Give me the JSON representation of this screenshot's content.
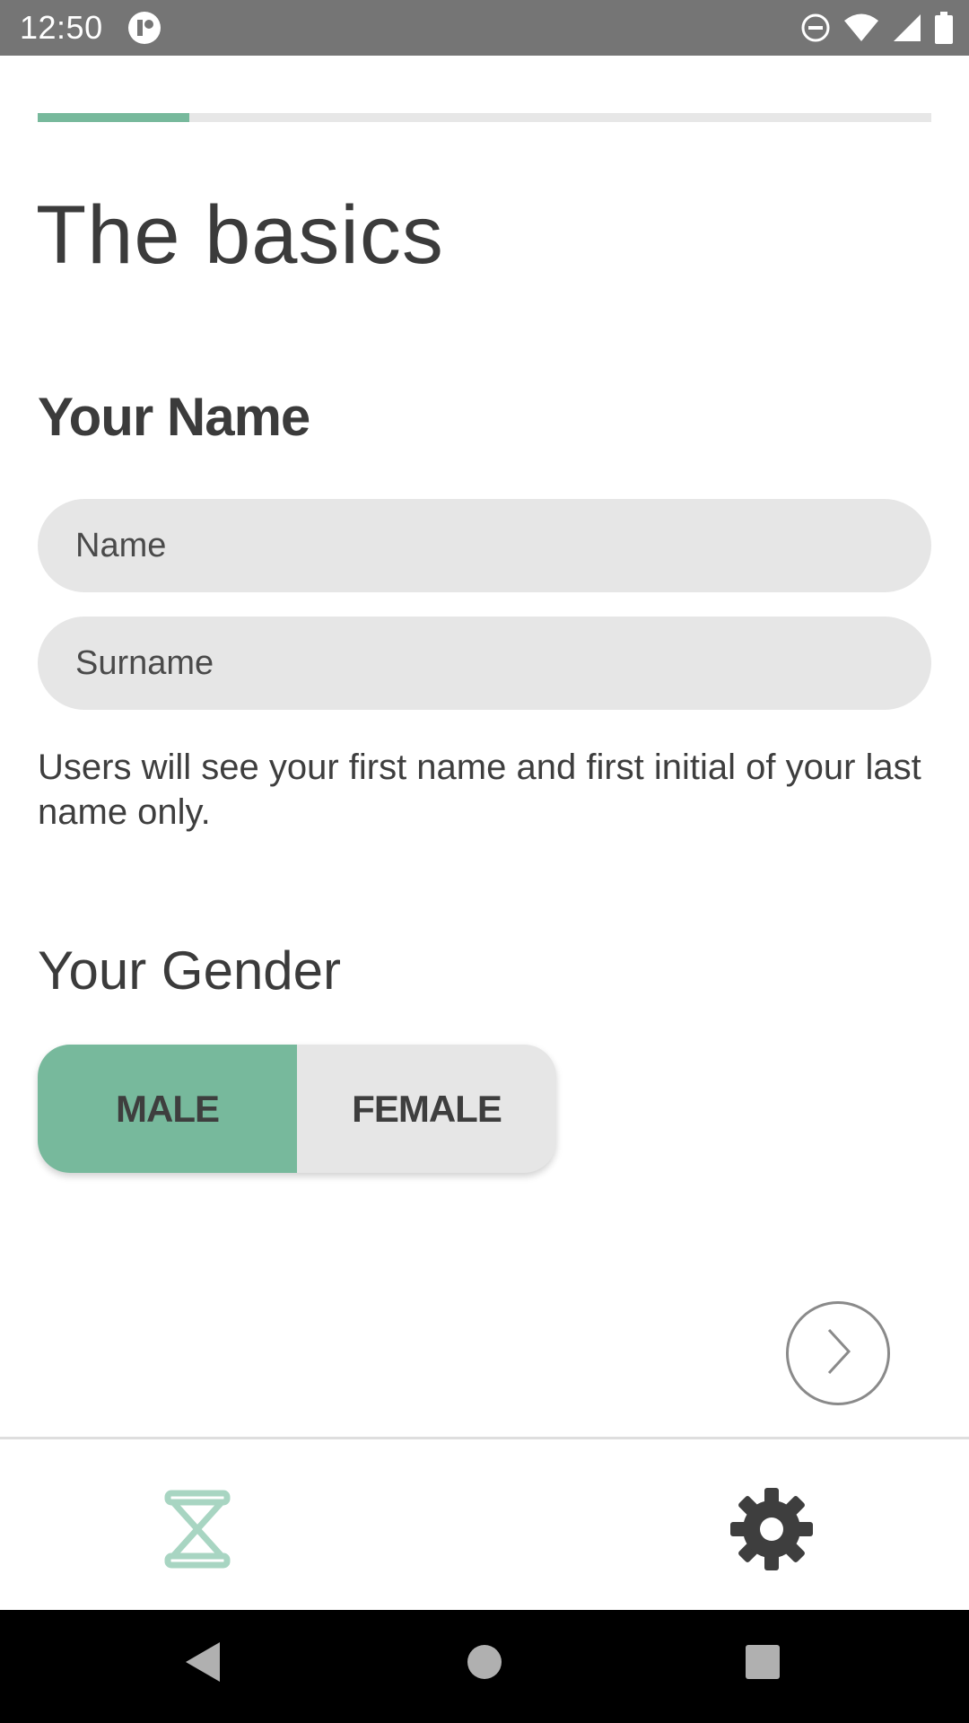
{
  "status_bar": {
    "time": "12:50",
    "icons": [
      "app-notification-icon",
      "do-not-disturb-icon",
      "wifi-icon",
      "cellular-signal-icon",
      "battery-icon"
    ]
  },
  "progress": {
    "fraction": 0.17,
    "color": "#77b99c",
    "track_color": "#e7e7e7"
  },
  "page": {
    "title": "The basics"
  },
  "name_section": {
    "heading": "Your Name",
    "name_input": {
      "placeholder": "Name",
      "value": ""
    },
    "surname_input": {
      "placeholder": "Surname",
      "value": ""
    },
    "helper_text": "Users will see your first name and first initial of your last name only."
  },
  "gender_section": {
    "heading": "Your Gender",
    "options": [
      {
        "label": "MALE",
        "selected": true
      },
      {
        "label": "FEMALE",
        "selected": false
      }
    ],
    "selected_color": "#77b99c"
  },
  "navigation": {
    "next_icon": "chevron-right-icon"
  },
  "bottom_nav": {
    "items": [
      {
        "icon": "hourglass-icon",
        "active": true,
        "color": "#a8d5c2"
      },
      {
        "icon": "gear-icon",
        "active": false,
        "color": "#3e3e3e"
      }
    ]
  },
  "system_nav": {
    "icons": [
      "back-icon",
      "home-icon",
      "recents-icon"
    ]
  }
}
